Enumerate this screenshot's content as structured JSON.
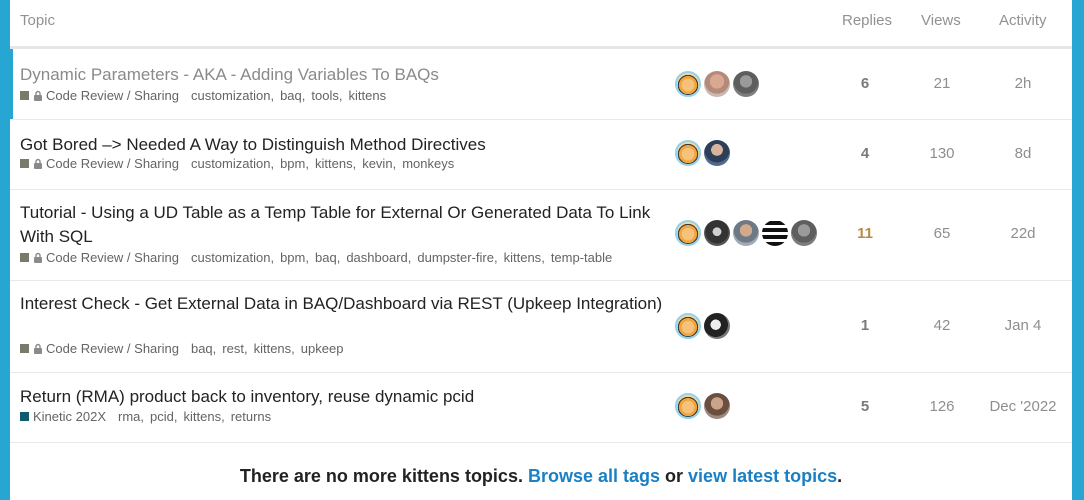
{
  "header": {
    "topic": "Topic",
    "replies": "Replies",
    "views": "Views",
    "activity": "Activity"
  },
  "topics": [
    {
      "title": "Dynamic Parameters - AKA - Adding Variables To BAQs",
      "category": "Code Review / Sharing",
      "category_color": "#7a7a6a",
      "locked": true,
      "tags": [
        "customization",
        "baq",
        "tools",
        "kittens"
      ],
      "replies": "6",
      "views": "21",
      "activity": "2h",
      "avatars": [
        "avatar-kitten-op",
        "avatar-user-bald",
        "avatar-user-gray"
      ]
    },
    {
      "title": "Got Bored –> Needed A Way to Distinguish Method Directives",
      "category": "Code Review / Sharing",
      "category_color": "#7a7a6a",
      "locked": true,
      "tags": [
        "customization",
        "bpm",
        "kittens",
        "kevin",
        "monkeys"
      ],
      "replies": "4",
      "views": "130",
      "activity": "8d",
      "avatars": [
        "avatar-kitten-op",
        "avatar-user-suit"
      ]
    },
    {
      "title": "Tutorial - Using a UD Table as a Temp Table for External Or Generated Data To Link With SQL",
      "category": "Code Review / Sharing",
      "category_color": "#7a7a6a",
      "locked": true,
      "tags": [
        "customization",
        "bpm",
        "baq",
        "dashboard",
        "dumpster-fire",
        "kittens",
        "temp-table"
      ],
      "replies": "11",
      "views": "65",
      "activity": "22d",
      "avatars": [
        "avatar-kitten-op",
        "avatar-user-dark",
        "avatar-user-glasses",
        "avatar-user-logo",
        "avatar-user-gray"
      ]
    },
    {
      "title": "Interest Check - Get External Data in BAQ/Dashboard via REST (Upkeep Integration)",
      "category": "Code Review / Sharing",
      "category_color": "#7a7a6a",
      "locked": true,
      "tags": [
        "baq",
        "rest",
        "kittens",
        "upkeep"
      ],
      "replies": "1",
      "views": "42",
      "activity": "Jan 4",
      "avatars": [
        "avatar-kitten-op",
        "avatar-user-bw"
      ]
    },
    {
      "title": "Return (RMA) product back to inventory, reuse dynamic pcid",
      "category": "Kinetic 202X",
      "category_color": "#0e5c6e",
      "locked": false,
      "tags": [
        "rma",
        "pcid",
        "kittens",
        "returns"
      ],
      "replies": "5",
      "views": "126",
      "activity": "Dec '2022",
      "avatars": [
        "avatar-kitten-op",
        "avatar-user-beard"
      ]
    }
  ],
  "footer": {
    "text": "There are no more kittens topics.",
    "browse_link": "Browse all tags",
    "or": "or",
    "latest_link": "view latest topics",
    "period": "."
  }
}
